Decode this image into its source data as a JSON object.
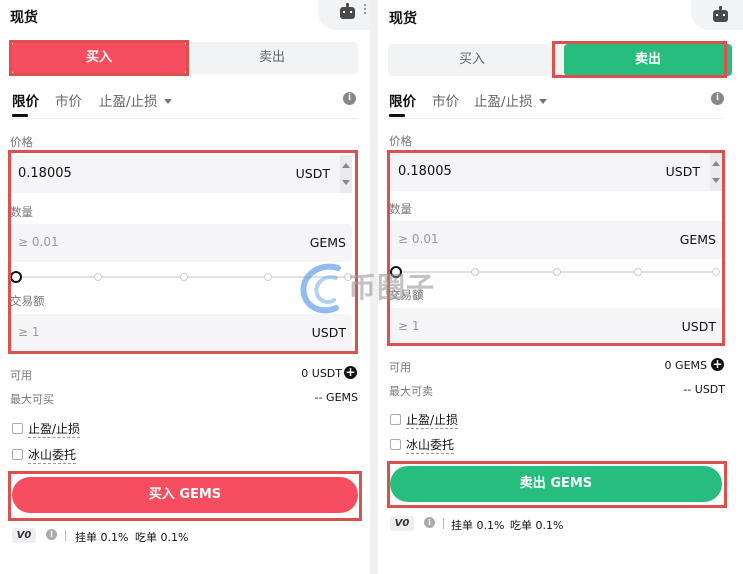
{
  "buy_panel": {
    "title": "现货",
    "toggle": {
      "buy": "买入",
      "sell": "卖出"
    },
    "tabs": {
      "limit": "限价",
      "market": "市价",
      "tpsl": "止盈/止损"
    },
    "price": {
      "label": "价格",
      "value": "0.18005",
      "unit": "USDT"
    },
    "amount": {
      "label": "数量",
      "placeholder": "≥ 0.01",
      "unit": "GEMS"
    },
    "slider_value_percent": 0,
    "total": {
      "label": "交易额",
      "placeholder": "≥ 1",
      "unit": "USDT"
    },
    "available": {
      "label": "可用",
      "value": "0 USDT"
    },
    "max": {
      "label": "最大可买",
      "value": "-- GEMS"
    },
    "options": {
      "tpsl": "止盈/止损",
      "iceberg": "冰山委托"
    },
    "action": "买入 GEMS",
    "fees": {
      "vip": "V0",
      "maker": "挂单 0.1%",
      "taker": "吃单 0.1%"
    }
  },
  "sell_panel": {
    "title": "现货",
    "toggle": {
      "buy": "买入",
      "sell": "卖出"
    },
    "tabs": {
      "limit": "限价",
      "market": "市价",
      "tpsl": "止盈/止损"
    },
    "price": {
      "label": "价格",
      "value": "0.18005",
      "unit": "USDT"
    },
    "amount": {
      "label": "数量",
      "placeholder": "≥ 0.01",
      "unit": "GEMS"
    },
    "slider_value_percent": 0,
    "total": {
      "label": "交易额",
      "placeholder": "≥ 1",
      "unit": "USDT"
    },
    "available": {
      "label": "可用",
      "value": "0 GEMS"
    },
    "max": {
      "label": "最大可卖",
      "value": "-- USDT"
    },
    "options": {
      "tpsl": "止盈/止损",
      "iceberg": "冰山委托"
    },
    "action": "卖出 GEMS",
    "fees": {
      "vip": "V0",
      "maker": "挂单 0.1%",
      "taker": "吃单 0.1%"
    }
  },
  "icons": {
    "robot": "robot-icon",
    "info": "info-icon",
    "plus": "plus-circle-icon",
    "checkbox": "checkbox-icon"
  },
  "colors": {
    "buy": "#f64e60",
    "sell": "#26bd7e",
    "highlight": "#d9524f"
  },
  "watermark": {
    "text": "币圈子"
  }
}
